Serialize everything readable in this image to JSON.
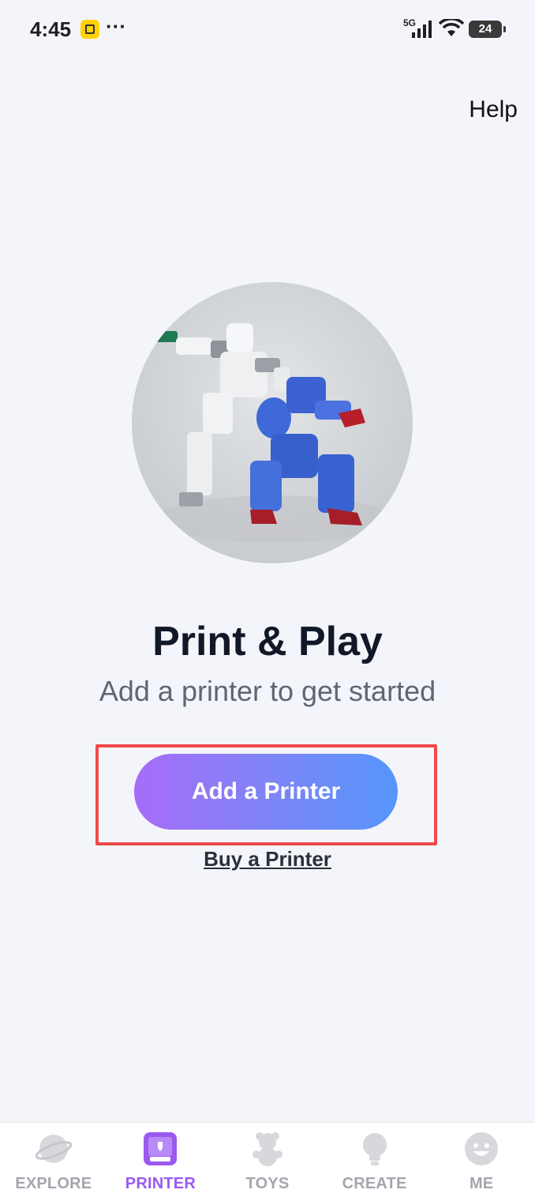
{
  "status_bar": {
    "time": "4:45",
    "dots": "···",
    "network": "5G",
    "battery": "24"
  },
  "header": {
    "help_label": "Help"
  },
  "hero": {
    "image": "robot-figures-image"
  },
  "main": {
    "title": "Print & Play",
    "subtitle": "Add a printer to get started",
    "add_printer_label": "Add a Printer",
    "buy_printer_label": "Buy a Printer"
  },
  "bottom_nav": {
    "items": [
      {
        "label": "EXPLORE",
        "icon": "planet-icon",
        "active": false
      },
      {
        "label": "PRINTER",
        "icon": "printer-icon",
        "active": true
      },
      {
        "label": "TOYS",
        "icon": "teddy-bear-icon",
        "active": false
      },
      {
        "label": "CREATE",
        "icon": "lightbulb-icon",
        "active": false
      },
      {
        "label": "ME",
        "icon": "smiley-face-icon",
        "active": false
      }
    ]
  },
  "colors": {
    "accent": "#9a5af0",
    "button_gradient_start": "#a66cf8",
    "button_gradient_end": "#5596fb",
    "highlight": "#ef4a4a",
    "background": "#f4f5fa"
  }
}
